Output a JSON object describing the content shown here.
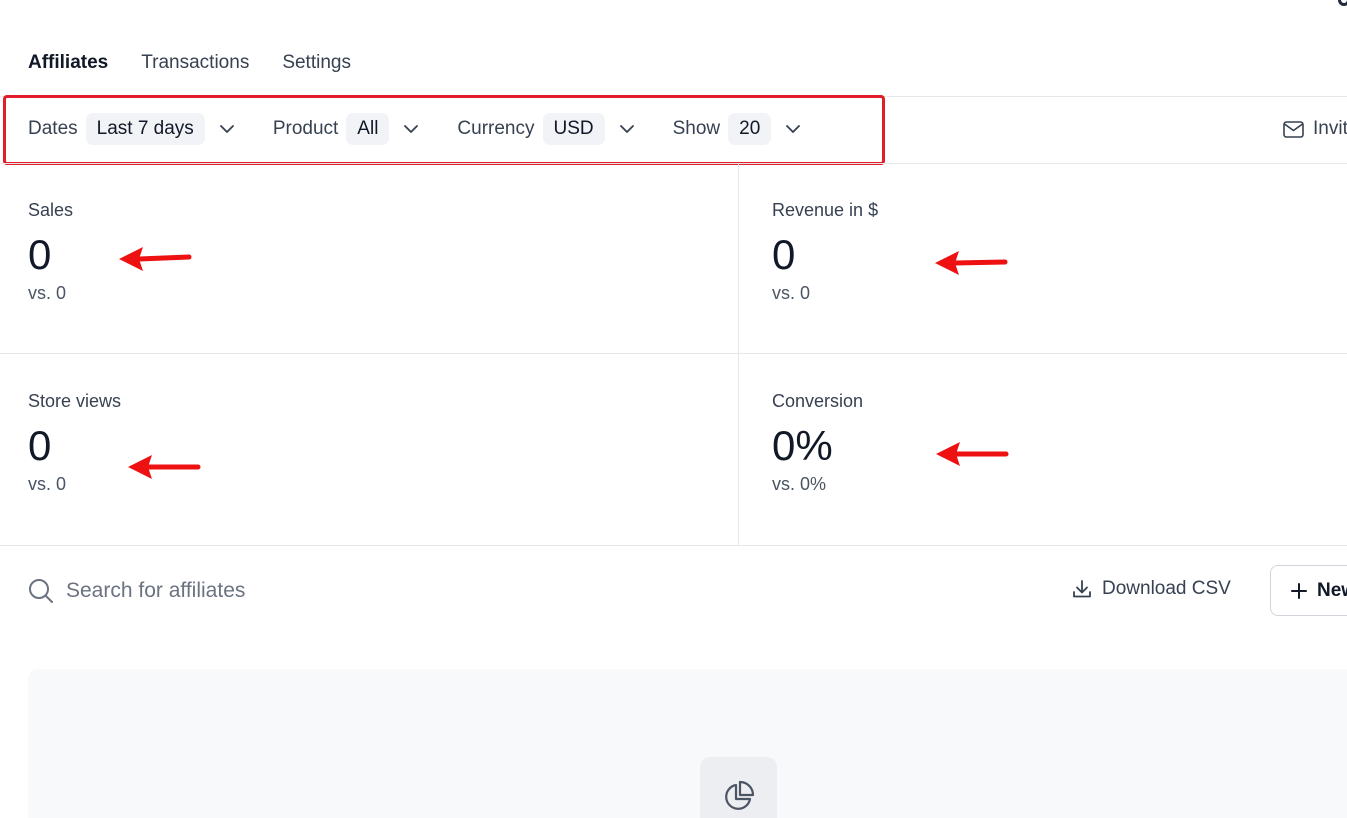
{
  "tabs": [
    {
      "label": "Affiliates",
      "active": true
    },
    {
      "label": "Transactions",
      "active": false
    },
    {
      "label": "Settings",
      "active": false
    }
  ],
  "filters": {
    "dates": {
      "label": "Dates",
      "value": "Last 7 days"
    },
    "product": {
      "label": "Product",
      "value": "All"
    },
    "currency": {
      "label": "Currency",
      "value": "USD"
    },
    "show": {
      "label": "Show",
      "value": "20"
    }
  },
  "invite": {
    "label": "Invit"
  },
  "stats": {
    "sales": {
      "title": "Sales",
      "value": "0",
      "compare": "vs. 0"
    },
    "revenue": {
      "title": "Revenue in $",
      "value": "0",
      "compare": "vs. 0"
    },
    "store_views": {
      "title": "Store views",
      "value": "0",
      "compare": "vs. 0"
    },
    "conversion": {
      "title": "Conversion",
      "value": "0%",
      "compare": "vs. 0%"
    }
  },
  "search": {
    "placeholder": "Search for affiliates"
  },
  "actions": {
    "download_csv": "Download CSV",
    "new": "New"
  },
  "colors": {
    "highlight": "#e11d2a",
    "annotation_arrow": "#ee1111",
    "pill_bg": "#f1f3f6"
  },
  "icons": [
    "search-icon",
    "download-icon",
    "plus-icon",
    "mail-icon",
    "chevron-down-icon",
    "pie-chart-icon"
  ]
}
